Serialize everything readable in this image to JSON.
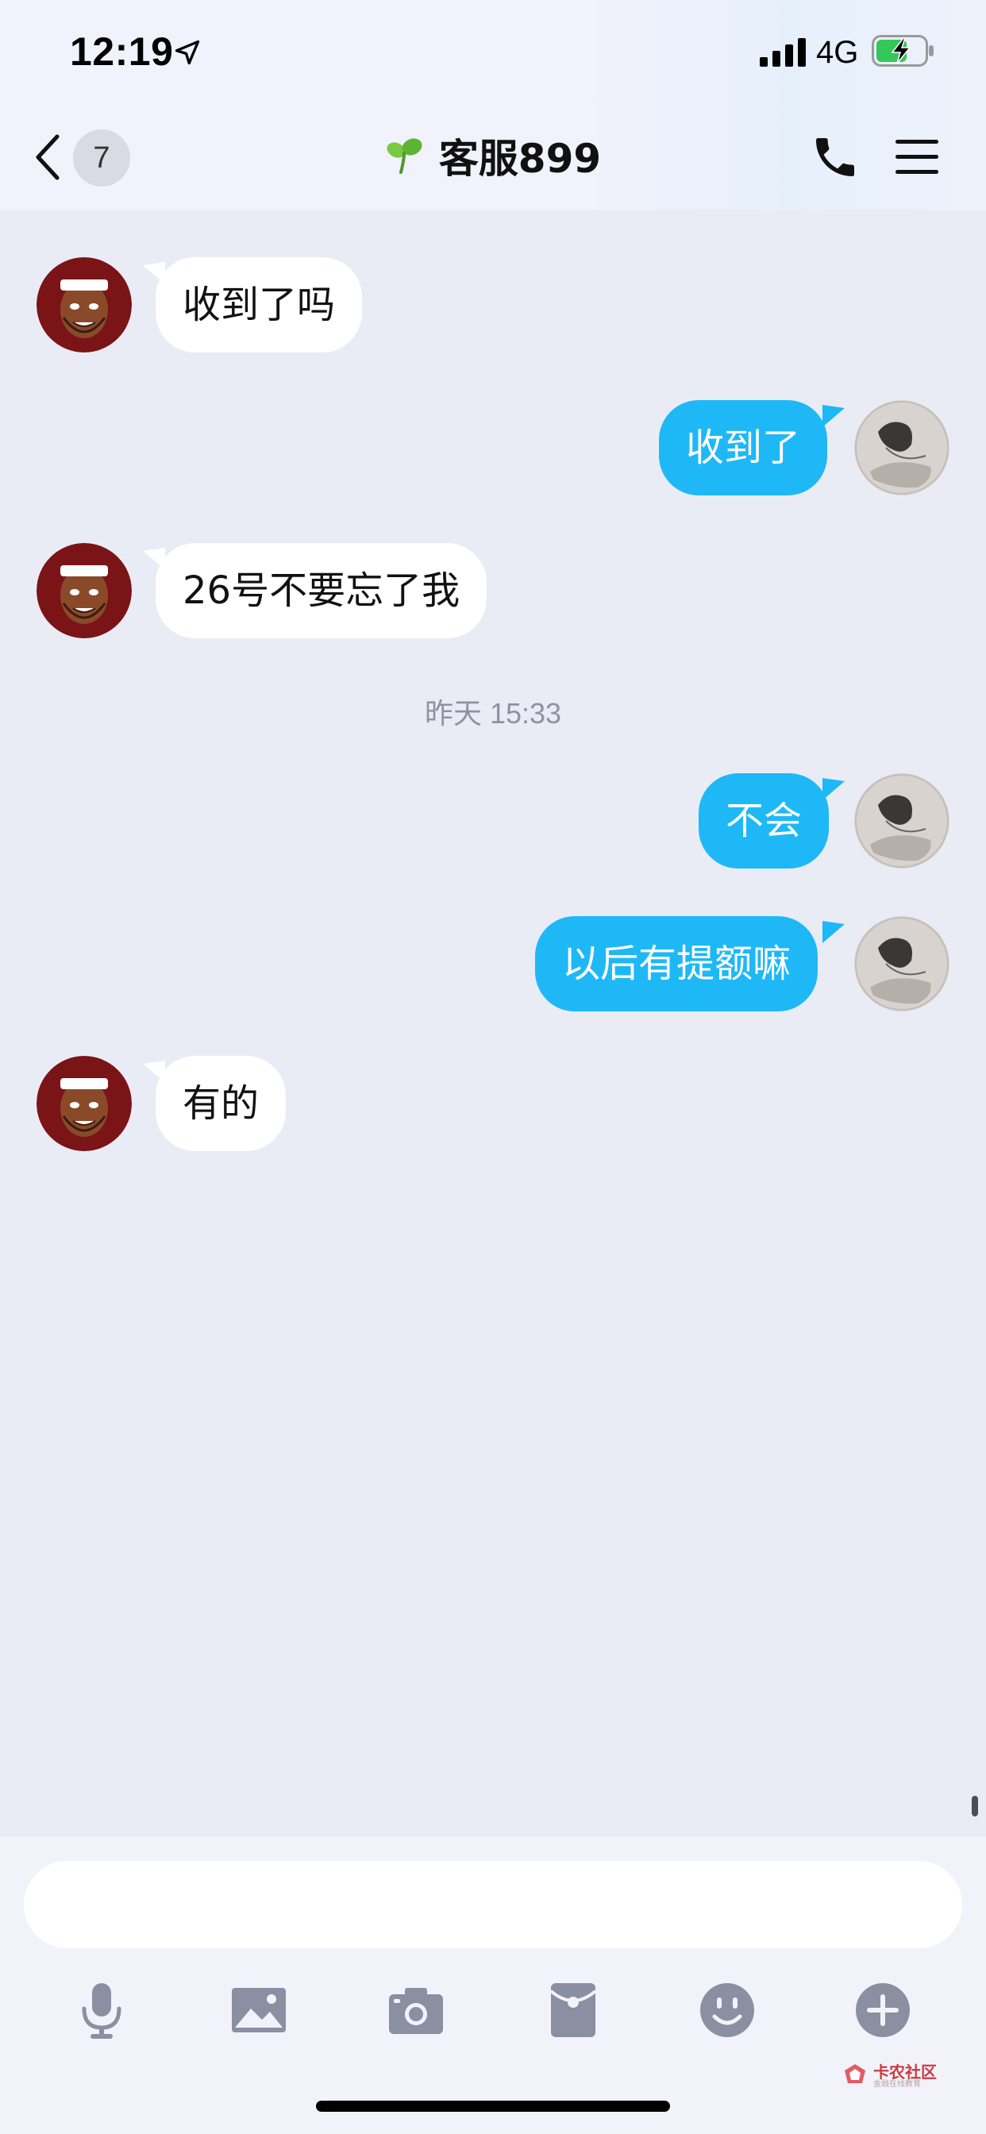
{
  "status_bar": {
    "time": "12:19",
    "network": "4G"
  },
  "header": {
    "back_badge": "7",
    "title": "客服899"
  },
  "messages": [
    {
      "side": "in",
      "text": "收到了吗"
    },
    {
      "side": "out",
      "text": "收到了"
    },
    {
      "side": "in",
      "text": "26号不要忘了我"
    },
    {
      "type": "timestamp",
      "text": "昨天 15:33"
    },
    {
      "side": "out",
      "text": "不会"
    },
    {
      "side": "out",
      "text": "以后有提额嘛"
    },
    {
      "side": "in",
      "text": "有的"
    }
  ],
  "composer": {
    "input_value": "",
    "tools": [
      "microphone-icon",
      "image-icon",
      "camera-icon",
      "red-packet-icon",
      "emoji-icon",
      "plus-icon"
    ]
  },
  "watermark": {
    "text": "卡农社区",
    "sub": "金融在线教育"
  },
  "colors": {
    "outgoing_bubble": "#1eb8f7",
    "incoming_bubble": "#ffffff",
    "background": "#eaecf5",
    "battery_fill": "#34c759"
  }
}
